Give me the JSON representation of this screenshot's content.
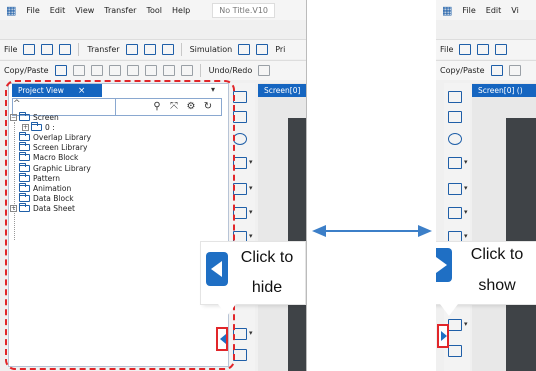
{
  "left": {
    "menu": {
      "file": "File",
      "edit": "Edit",
      "view": "View",
      "transfer": "Transfer",
      "tool": "Tool",
      "help": "Help",
      "title": "No Title.V10"
    },
    "toolbar1": {
      "file": "File",
      "transfer": "Transfer",
      "simulation": "Simulation",
      "pr": "Pri"
    },
    "toolbar2": {
      "copy_paste": "Copy/Paste",
      "undo_redo": "Undo/Redo"
    },
    "project_view": {
      "tab_label": "Project View",
      "close_glyph": "×",
      "pin_glyph": "▾",
      "tree": [
        {
          "label": "Screen",
          "expander": "−"
        },
        {
          "label": "0 :",
          "expander": "+"
        },
        {
          "label": "Overlap Library",
          "expander": ""
        },
        {
          "label": "Screen Library",
          "expander": ""
        },
        {
          "label": "Macro Block",
          "expander": ""
        },
        {
          "label": "Graphic Library",
          "expander": ""
        },
        {
          "label": "Pattern",
          "expander": ""
        },
        {
          "label": "Animation",
          "expander": ""
        },
        {
          "label": "Data Block",
          "expander": ""
        },
        {
          "label": "Data Sheet",
          "expander": "+"
        }
      ]
    },
    "screen_tab": "Screen[0]",
    "callout": {
      "line1": "Click to",
      "line2": "hide"
    }
  },
  "right": {
    "menu": {
      "file": "File",
      "edit": "Edit",
      "view": "Vi"
    },
    "toolbar1": {
      "file": "File"
    },
    "toolbar2": {
      "copy_paste": "Copy/Paste"
    },
    "screen_tab": "Screen[0] ()",
    "callout": {
      "line1": "Click to",
      "line2": "show"
    }
  },
  "colors": {
    "accent": "#1565c0",
    "highlight": "#e1262a",
    "arrow": "#1f6fc4"
  },
  "icons": {
    "app": "app-icon",
    "search": "search-icon",
    "collapse": "collapse-all-icon",
    "settings": "gear-icon",
    "refresh": "refresh-icon",
    "folder": "folder-icon"
  }
}
